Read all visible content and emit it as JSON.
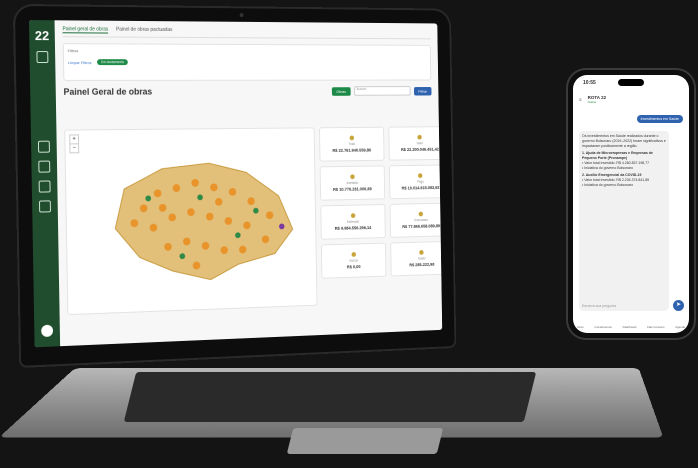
{
  "laptop": {
    "logo": "22",
    "tabs": [
      "Painel geral de obras",
      "Painel de obras pactuadas"
    ],
    "filters_label": "Filtros",
    "clear_filters": "Limpar Filtros",
    "active_chip": "Em Andamento",
    "title": "Painel Geral de obras",
    "btn_green": "Obras",
    "search_placeholder": "Buscar",
    "btn_blue": "Filtrar",
    "zoom_in": "+",
    "zoom_out": "−",
    "stats": [
      {
        "label": "Total",
        "value": "R$ 22.761.940.559,86"
      },
      {
        "label": "Valor",
        "value": "R$ 22.200.046.451,42"
      },
      {
        "label": "Investido",
        "value": "R$ 10.776.261.000,69"
      },
      {
        "label": "Pago",
        "value": "R$ 10.014.615.083,92"
      },
      {
        "label": "Estimado",
        "value": "R$ 9.984.556.296,14"
      },
      {
        "label": "Executado",
        "value": "R$ 77.666.658.089,89"
      },
      {
        "label": "Outros",
        "value": "R$ 0,00"
      },
      {
        "label": "Saldo",
        "value": "R$ 285.222,98"
      }
    ]
  },
  "phone": {
    "time": "10:55",
    "chat_title": "ROTA 22",
    "chat_status": "Online",
    "user_message": "investimentos em Saúde",
    "bot_lines": [
      "Os investimentos em Saúde realizados durante o governo Bolsonaro (2019–2022) foram significativos e impactaram positivamente a região.",
      "1. Ajuda de Microempresas e Empresas de Pequeno Porte (Pronampe)",
      "• Valor total investido: R$ 4.260.837.198,77",
      "• Iniciativa do governo Bolsonaro",
      "2. Auxílio Emergencial da COVID-19",
      "• Valor total investido: R$ 2.234.374.841,85",
      "• Iniciativa do governo Bolsonaro"
    ],
    "input_placeholder": "Escreva sua pergunta",
    "nav": [
      "Início",
      "Investimentos",
      "Dashboard",
      "Fale Conosco",
      "Agenda"
    ]
  }
}
